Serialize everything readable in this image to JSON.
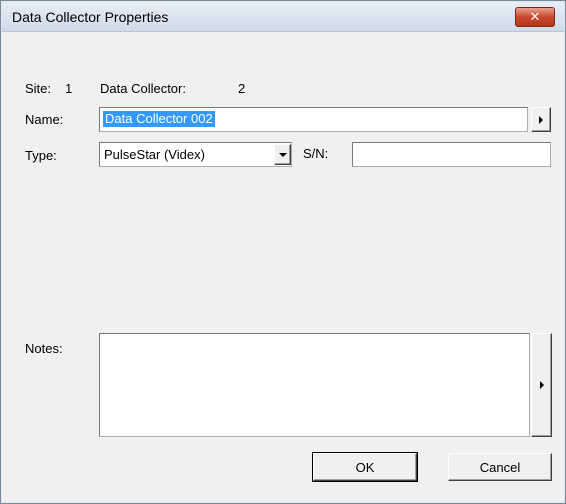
{
  "window": {
    "title": "Data Collector Properties",
    "close_glyph": "✕"
  },
  "info": {
    "site_label": "Site:",
    "site_value": "1",
    "collector_label": "Data Collector:",
    "collector_value": "2"
  },
  "form": {
    "name_label": "Name:",
    "name_value": "Data Collector 002",
    "type_label": "Type:",
    "type_value": "PulseStar (Videx)",
    "sn_label": "S/N:",
    "sn_value": "",
    "notes_label": "Notes:",
    "notes_value": ""
  },
  "buttons": {
    "ok": "OK",
    "cancel": "Cancel"
  },
  "icons": {
    "close": "close-icon",
    "name_expand": "arrow-right-icon",
    "type_dropdown": "chevron-down-icon",
    "notes_expand": "arrow-right-icon"
  },
  "colors": {
    "selection": "#3399ff",
    "close_button": "#c7492e",
    "dialog_bg": "#f0f0f0"
  }
}
